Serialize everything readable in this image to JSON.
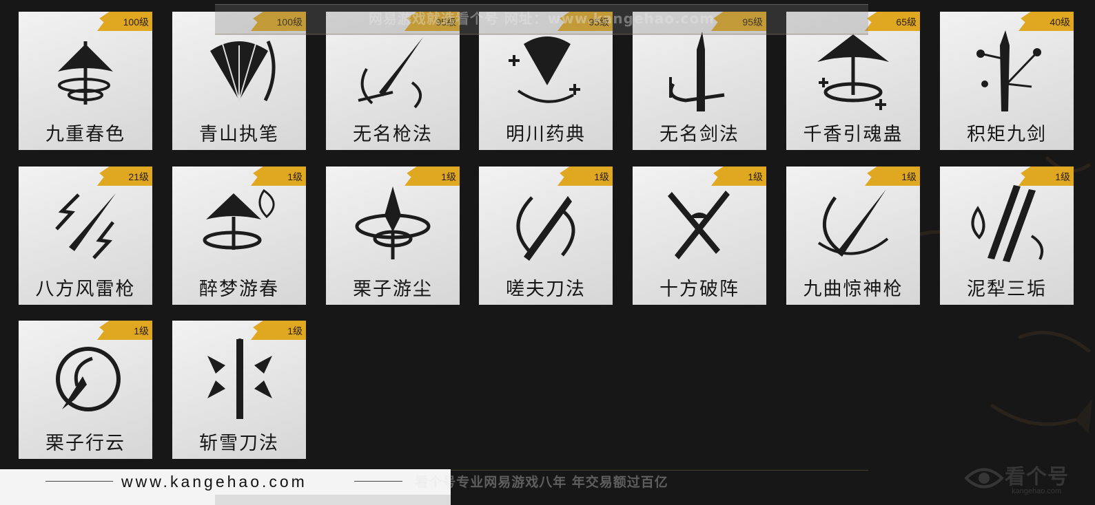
{
  "watermark_top": "网易游戏就选看个号  网址：www.kangehao.com",
  "watermark_bottom": "看个号专业网易游戏八年  年交易额过百亿",
  "footer_url": "www.kangehao.com",
  "logo": {
    "text": "看个号",
    "sub": "kangehao.com"
  },
  "accent_color": "#e0a820",
  "skills": [
    {
      "name": "九重春色",
      "level": "100级",
      "icon": "straw-hat-vortex-icon"
    },
    {
      "name": "青山执笔",
      "level": "100级",
      "icon": "folding-fan-icon"
    },
    {
      "name": "无名枪法",
      "level": "95级",
      "icon": "spear-slash-icon"
    },
    {
      "name": "明川药典",
      "level": "95级",
      "icon": "fan-heal-icon"
    },
    {
      "name": "无名剑法",
      "level": "95级",
      "icon": "sword-ring-icon"
    },
    {
      "name": "千香引魂蛊",
      "level": "65级",
      "icon": "umbrella-heal-icon"
    },
    {
      "name": "积矩九剑",
      "level": "40级",
      "icon": "sword-constellation-icon"
    },
    {
      "name": "八方风雷枪",
      "level": "21级",
      "icon": "lightning-spear-icon"
    },
    {
      "name": "醉梦游春",
      "level": "1级",
      "icon": "hat-butterfly-icon"
    },
    {
      "name": "栗子游尘",
      "level": "1级",
      "icon": "spiral-spike-icon"
    },
    {
      "name": "嗟夫刀法",
      "level": "1级",
      "icon": "blade-circle-icon"
    },
    {
      "name": "十方破阵",
      "level": "1级",
      "icon": "crossed-blades-icon"
    },
    {
      "name": "九曲惊神枪",
      "level": "1级",
      "icon": "spear-orbit-icon"
    },
    {
      "name": "泥犁三垢",
      "level": "1级",
      "icon": "triple-claw-icon"
    },
    {
      "name": "栗子行云",
      "level": "1级",
      "icon": "dart-swirl-icon"
    },
    {
      "name": "斩雪刀法",
      "level": "1级",
      "icon": "saber-snowflake-icon"
    }
  ]
}
